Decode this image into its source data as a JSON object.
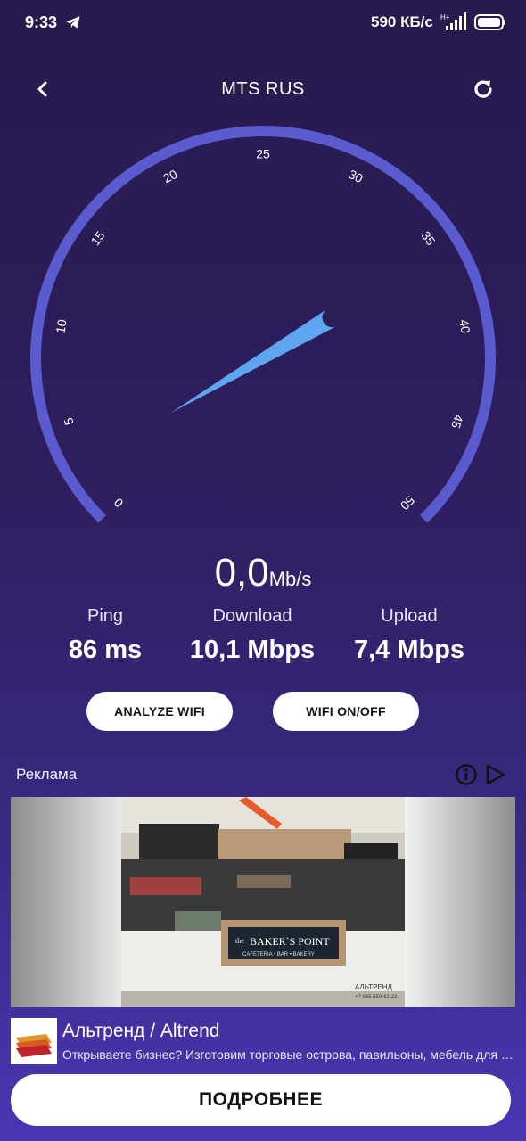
{
  "status_bar": {
    "time": "9:33",
    "net_speed": "590 КБ/с",
    "icons": [
      "telegram-icon",
      "signal-icon",
      "battery-icon"
    ]
  },
  "header": {
    "title": "MTS RUS",
    "back_icon": "chevron-left-icon",
    "refresh_icon": "refresh-icon"
  },
  "gauge": {
    "ticks": [
      "0",
      "5",
      "10",
      "15",
      "20",
      "25",
      "30",
      "35",
      "40",
      "45",
      "50"
    ],
    "min": 0,
    "max": 50,
    "needle_value": 36,
    "arc_color": "#5b5bd0",
    "needle_color": "#5ea6f0"
  },
  "current_speed": {
    "value": "0,0",
    "unit": "Mb/s"
  },
  "metrics": {
    "ping": {
      "label": "Ping",
      "value": "86 ms"
    },
    "download": {
      "label": "Download",
      "value": "10,1 Mbps"
    },
    "upload": {
      "label": "Upload",
      "value": "7,4 Mbps"
    }
  },
  "buttons": {
    "analyze": "ANALYZE WIFI",
    "wifi_toggle": "WIFI ON/OFF"
  },
  "ad": {
    "label": "Реклама",
    "sign_small": "the",
    "sign_main": "BAKER`S POINT",
    "sign_sub": "CAFETERIA • BAR • BAKERY",
    "watermark": "АЛЬТРЕНД",
    "watermark_phone": "+7 985 550-62-22",
    "advertiser": "Альтренд / Altrend",
    "description": "Открываете бизнес? Изготовим торговые острова, павильоны, мебель для кафе",
    "cta": "ПОДРОБНЕЕ"
  }
}
